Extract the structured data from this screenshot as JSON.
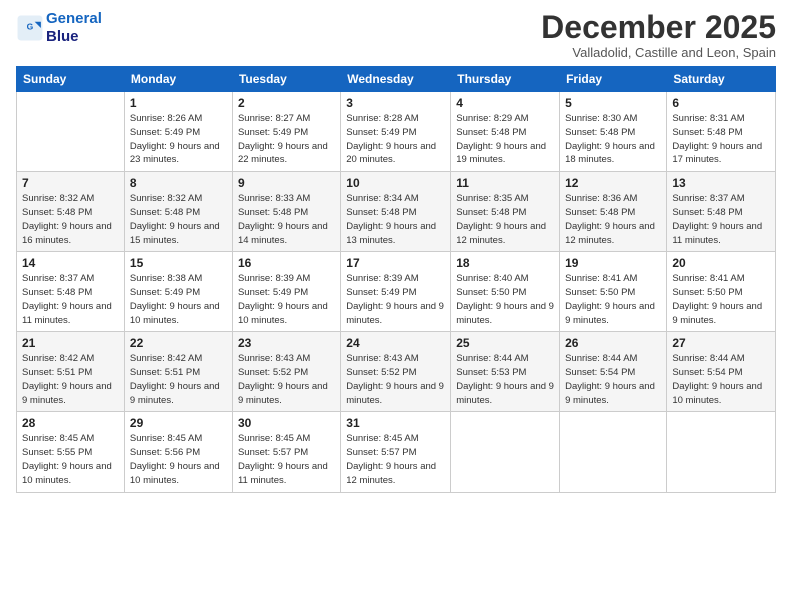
{
  "logo": {
    "line1": "General",
    "line2": "Blue"
  },
  "title": "December 2025",
  "subtitle": "Valladolid, Castille and Leon, Spain",
  "days_of_week": [
    "Sunday",
    "Monday",
    "Tuesday",
    "Wednesday",
    "Thursday",
    "Friday",
    "Saturday"
  ],
  "weeks": [
    [
      {
        "day": "",
        "sunrise": "",
        "sunset": "",
        "daylight": ""
      },
      {
        "day": "1",
        "sunrise": "Sunrise: 8:26 AM",
        "sunset": "Sunset: 5:49 PM",
        "daylight": "Daylight: 9 hours and 23 minutes."
      },
      {
        "day": "2",
        "sunrise": "Sunrise: 8:27 AM",
        "sunset": "Sunset: 5:49 PM",
        "daylight": "Daylight: 9 hours and 22 minutes."
      },
      {
        "day": "3",
        "sunrise": "Sunrise: 8:28 AM",
        "sunset": "Sunset: 5:49 PM",
        "daylight": "Daylight: 9 hours and 20 minutes."
      },
      {
        "day": "4",
        "sunrise": "Sunrise: 8:29 AM",
        "sunset": "Sunset: 5:48 PM",
        "daylight": "Daylight: 9 hours and 19 minutes."
      },
      {
        "day": "5",
        "sunrise": "Sunrise: 8:30 AM",
        "sunset": "Sunset: 5:48 PM",
        "daylight": "Daylight: 9 hours and 18 minutes."
      },
      {
        "day": "6",
        "sunrise": "Sunrise: 8:31 AM",
        "sunset": "Sunset: 5:48 PM",
        "daylight": "Daylight: 9 hours and 17 minutes."
      }
    ],
    [
      {
        "day": "7",
        "sunrise": "Sunrise: 8:32 AM",
        "sunset": "Sunset: 5:48 PM",
        "daylight": "Daylight: 9 hours and 16 minutes."
      },
      {
        "day": "8",
        "sunrise": "Sunrise: 8:32 AM",
        "sunset": "Sunset: 5:48 PM",
        "daylight": "Daylight: 9 hours and 15 minutes."
      },
      {
        "day": "9",
        "sunrise": "Sunrise: 8:33 AM",
        "sunset": "Sunset: 5:48 PM",
        "daylight": "Daylight: 9 hours and 14 minutes."
      },
      {
        "day": "10",
        "sunrise": "Sunrise: 8:34 AM",
        "sunset": "Sunset: 5:48 PM",
        "daylight": "Daylight: 9 hours and 13 minutes."
      },
      {
        "day": "11",
        "sunrise": "Sunrise: 8:35 AM",
        "sunset": "Sunset: 5:48 PM",
        "daylight": "Daylight: 9 hours and 12 minutes."
      },
      {
        "day": "12",
        "sunrise": "Sunrise: 8:36 AM",
        "sunset": "Sunset: 5:48 PM",
        "daylight": "Daylight: 9 hours and 12 minutes."
      },
      {
        "day": "13",
        "sunrise": "Sunrise: 8:37 AM",
        "sunset": "Sunset: 5:48 PM",
        "daylight": "Daylight: 9 hours and 11 minutes."
      }
    ],
    [
      {
        "day": "14",
        "sunrise": "Sunrise: 8:37 AM",
        "sunset": "Sunset: 5:48 PM",
        "daylight": "Daylight: 9 hours and 11 minutes."
      },
      {
        "day": "15",
        "sunrise": "Sunrise: 8:38 AM",
        "sunset": "Sunset: 5:49 PM",
        "daylight": "Daylight: 9 hours and 10 minutes."
      },
      {
        "day": "16",
        "sunrise": "Sunrise: 8:39 AM",
        "sunset": "Sunset: 5:49 PM",
        "daylight": "Daylight: 9 hours and 10 minutes."
      },
      {
        "day": "17",
        "sunrise": "Sunrise: 8:39 AM",
        "sunset": "Sunset: 5:49 PM",
        "daylight": "Daylight: 9 hours and 9 minutes."
      },
      {
        "day": "18",
        "sunrise": "Sunrise: 8:40 AM",
        "sunset": "Sunset: 5:50 PM",
        "daylight": "Daylight: 9 hours and 9 minutes."
      },
      {
        "day": "19",
        "sunrise": "Sunrise: 8:41 AM",
        "sunset": "Sunset: 5:50 PM",
        "daylight": "Daylight: 9 hours and 9 minutes."
      },
      {
        "day": "20",
        "sunrise": "Sunrise: 8:41 AM",
        "sunset": "Sunset: 5:50 PM",
        "daylight": "Daylight: 9 hours and 9 minutes."
      }
    ],
    [
      {
        "day": "21",
        "sunrise": "Sunrise: 8:42 AM",
        "sunset": "Sunset: 5:51 PM",
        "daylight": "Daylight: 9 hours and 9 minutes."
      },
      {
        "day": "22",
        "sunrise": "Sunrise: 8:42 AM",
        "sunset": "Sunset: 5:51 PM",
        "daylight": "Daylight: 9 hours and 9 minutes."
      },
      {
        "day": "23",
        "sunrise": "Sunrise: 8:43 AM",
        "sunset": "Sunset: 5:52 PM",
        "daylight": "Daylight: 9 hours and 9 minutes."
      },
      {
        "day": "24",
        "sunrise": "Sunrise: 8:43 AM",
        "sunset": "Sunset: 5:52 PM",
        "daylight": "Daylight: 9 hours and 9 minutes."
      },
      {
        "day": "25",
        "sunrise": "Sunrise: 8:44 AM",
        "sunset": "Sunset: 5:53 PM",
        "daylight": "Daylight: 9 hours and 9 minutes."
      },
      {
        "day": "26",
        "sunrise": "Sunrise: 8:44 AM",
        "sunset": "Sunset: 5:54 PM",
        "daylight": "Daylight: 9 hours and 9 minutes."
      },
      {
        "day": "27",
        "sunrise": "Sunrise: 8:44 AM",
        "sunset": "Sunset: 5:54 PM",
        "daylight": "Daylight: 9 hours and 10 minutes."
      }
    ],
    [
      {
        "day": "28",
        "sunrise": "Sunrise: 8:45 AM",
        "sunset": "Sunset: 5:55 PM",
        "daylight": "Daylight: 9 hours and 10 minutes."
      },
      {
        "day": "29",
        "sunrise": "Sunrise: 8:45 AM",
        "sunset": "Sunset: 5:56 PM",
        "daylight": "Daylight: 9 hours and 10 minutes."
      },
      {
        "day": "30",
        "sunrise": "Sunrise: 8:45 AM",
        "sunset": "Sunset: 5:57 PM",
        "daylight": "Daylight: 9 hours and 11 minutes."
      },
      {
        "day": "31",
        "sunrise": "Sunrise: 8:45 AM",
        "sunset": "Sunset: 5:57 PM",
        "daylight": "Daylight: 9 hours and 12 minutes."
      },
      {
        "day": "",
        "sunrise": "",
        "sunset": "",
        "daylight": ""
      },
      {
        "day": "",
        "sunrise": "",
        "sunset": "",
        "daylight": ""
      },
      {
        "day": "",
        "sunrise": "",
        "sunset": "",
        "daylight": ""
      }
    ]
  ]
}
